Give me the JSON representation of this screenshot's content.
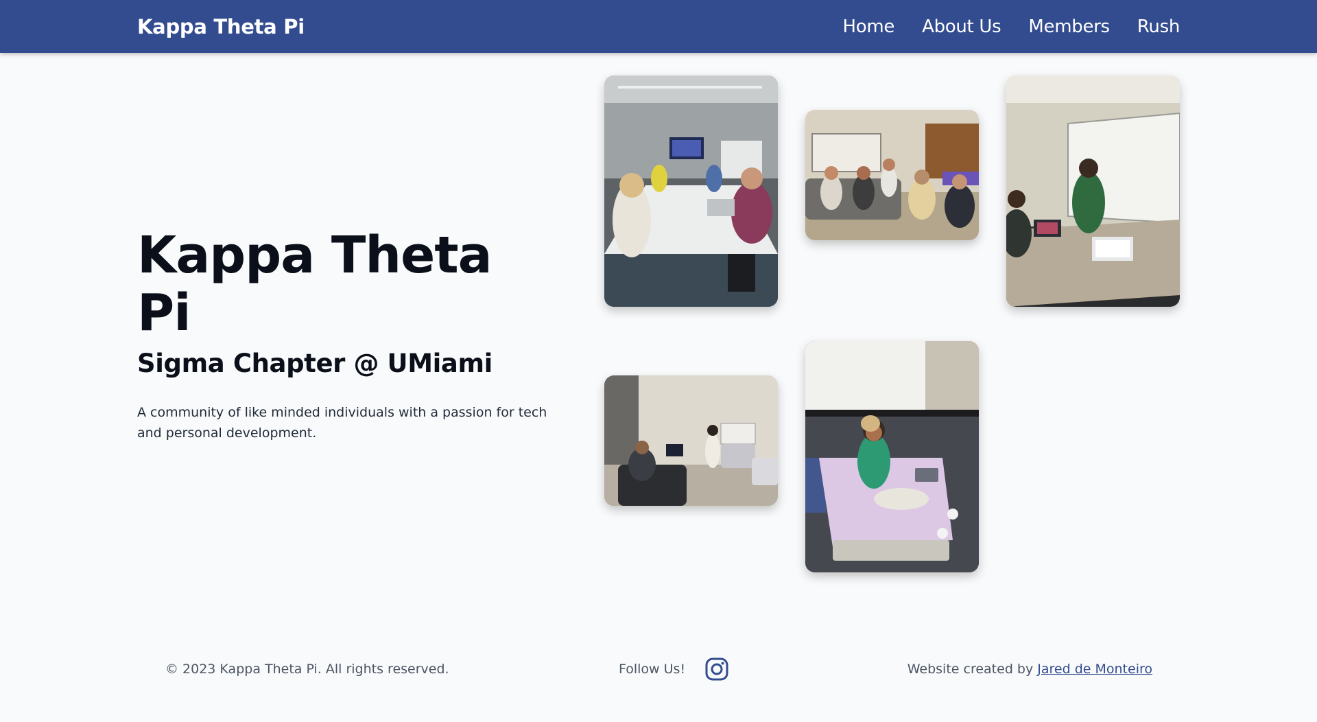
{
  "navbar": {
    "brand": "Kappa Theta Pi",
    "links": [
      "Home",
      "About Us",
      "Members",
      "Rush"
    ]
  },
  "hero": {
    "title": "Kappa Theta Pi",
    "subtitle": "Sigma Chapter @ UMiami",
    "description": "A community of like minded individuals with a passion for tech and personal development."
  },
  "footer": {
    "copyright": "© 2023 Kappa Theta Pi. All rights reserved.",
    "follow_label": "Follow Us!",
    "follow_icon": "instagram-icon",
    "credit_prefix": "Website created by",
    "credit_name": "Jared de Monteiro"
  },
  "colors": {
    "navbar": "#324c8f",
    "page_background": "#f9fafb",
    "link": "#324c8f"
  }
}
